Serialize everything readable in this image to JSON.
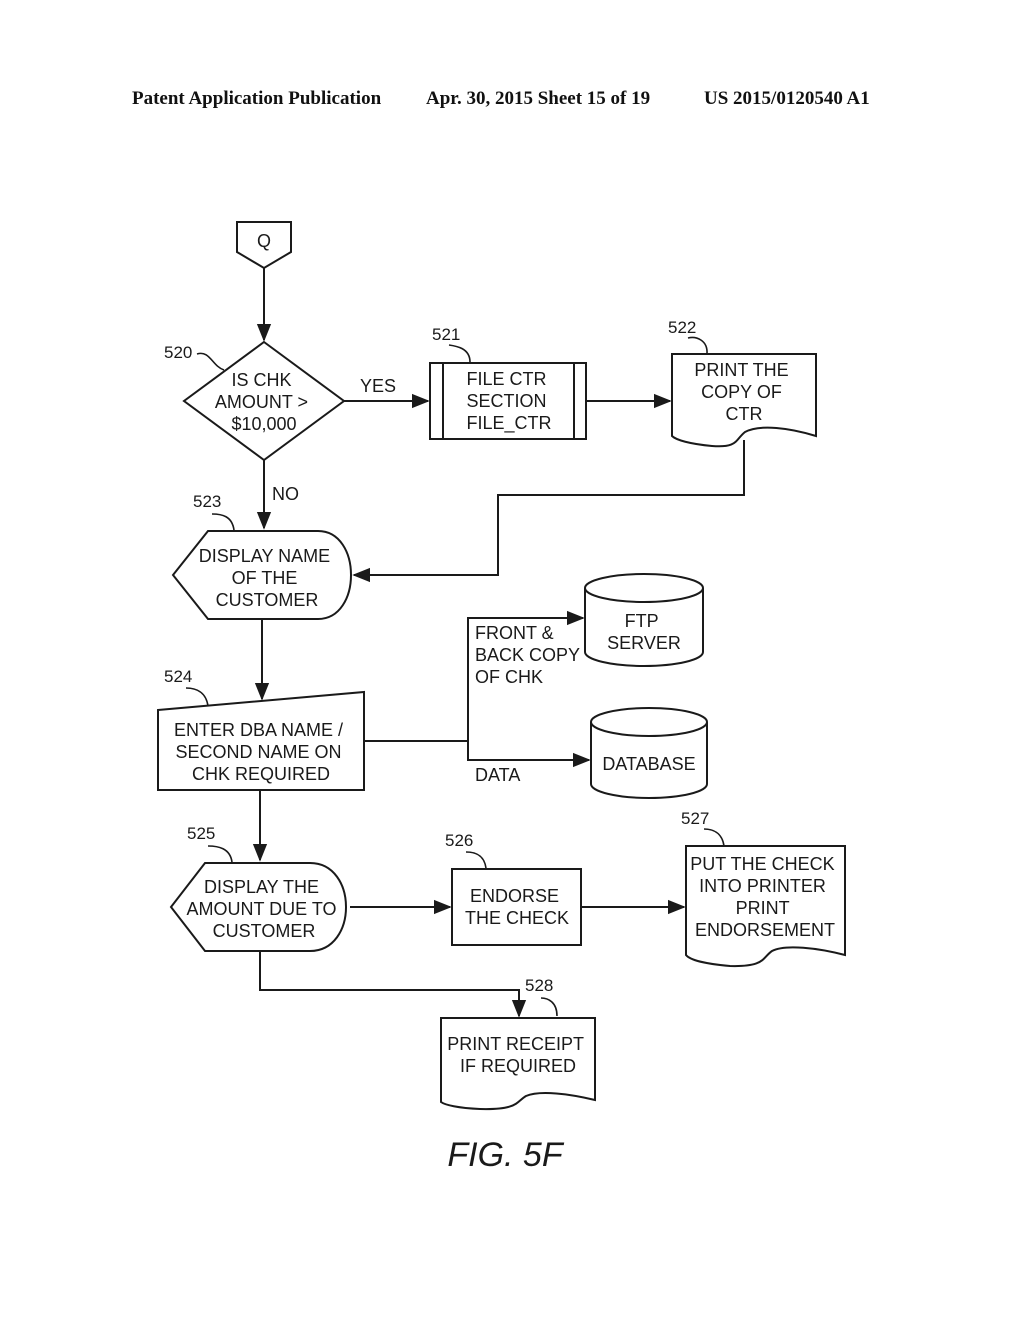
{
  "header": {
    "publication": "Patent Application Publication",
    "date_sheet": "Apr. 30, 2015  Sheet 15 of 19",
    "number": "US 2015/0120540 A1"
  },
  "figure_label": "FIG. 5F",
  "connector": {
    "label": "Q"
  },
  "nodes": {
    "n520": {
      "ref": "520",
      "lines": [
        "IS CHK",
        "AMOUNT >",
        "$10,000"
      ]
    },
    "n521": {
      "ref": "521",
      "lines": [
        "FILE CTR",
        "SECTION",
        "FILE_CTR"
      ]
    },
    "n522": {
      "ref": "522",
      "lines": [
        "PRINT THE",
        "COPY OF",
        "CTR"
      ]
    },
    "n523": {
      "ref": "523",
      "lines": [
        "DISPLAY NAME",
        "OF THE",
        "CUSTOMER"
      ]
    },
    "n524": {
      "ref": "524",
      "lines": [
        "ENTER DBA NAME /",
        "SECOND NAME ON",
        "CHK REQUIRED"
      ]
    },
    "ftp": {
      "lines": [
        "FTP",
        "SERVER"
      ]
    },
    "db": {
      "lines": [
        "DATABASE"
      ]
    },
    "n525": {
      "ref": "525",
      "lines": [
        "DISPLAY THE",
        "AMOUNT DUE TO",
        "CUSTOMER"
      ]
    },
    "n526": {
      "ref": "526",
      "lines": [
        "ENDORSE",
        "THE CHECK"
      ]
    },
    "n527": {
      "ref": "527",
      "lines": [
        "PUT THE CHECK",
        "INTO PRINTER",
        "PRINT",
        "ENDORSEMENT"
      ]
    },
    "n528": {
      "ref": "528",
      "lines": [
        "PRINT RECEIPT",
        "IF REQUIRED"
      ]
    }
  },
  "edge_labels": {
    "yes": "YES",
    "no": "NO",
    "front_back": [
      "FRONT &",
      "BACK COPY",
      "OF CHK"
    ],
    "data": "DATA"
  }
}
